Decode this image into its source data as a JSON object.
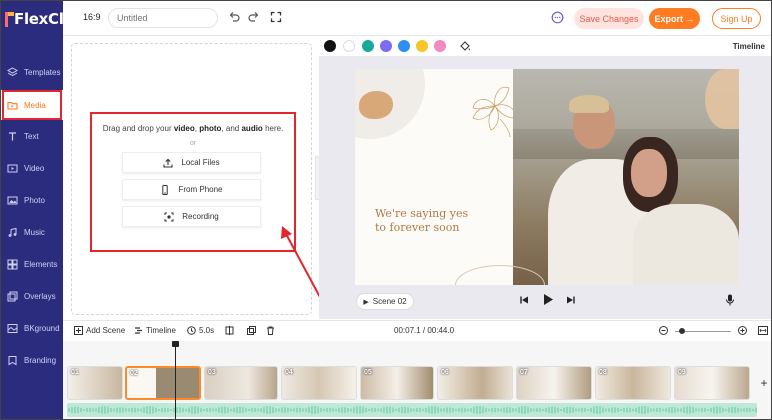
{
  "app": {
    "logo_text": "FlexClip"
  },
  "topbar": {
    "aspect_ratio": "16:9",
    "title_placeholder": "Untitled",
    "save_label": "Save Changes",
    "export_label": "Export →",
    "signup_label": "Sign Up"
  },
  "sidebar": {
    "items": [
      {
        "label": "Templates",
        "icon": "layers-icon"
      },
      {
        "label": "Media",
        "icon": "folder-icon",
        "active": true
      },
      {
        "label": "Text",
        "icon": "text-icon"
      },
      {
        "label": "Video",
        "icon": "video-icon"
      },
      {
        "label": "Photo",
        "icon": "photo-icon"
      },
      {
        "label": "Music",
        "icon": "music-icon"
      },
      {
        "label": "Elements",
        "icon": "elements-icon"
      },
      {
        "label": "Overlays",
        "icon": "overlays-icon"
      },
      {
        "label": "BKground",
        "icon": "background-icon"
      },
      {
        "label": "Branding",
        "icon": "branding-icon"
      }
    ]
  },
  "media": {
    "drag_prefix": "Drag and drop your",
    "drag_video": "video",
    "drag_comma": ",",
    "drag_photo": "photo",
    "drag_and": ", and",
    "drag_audio": "audio",
    "drag_suffix": "here.",
    "or_label": "or",
    "local_files": "Local Files",
    "from_phone": "From Phone",
    "recording": "Recording"
  },
  "canvas": {
    "colors": [
      "#111111",
      "#ffffff",
      "#1aa89a",
      "#7b6cf0",
      "#2f8ef0",
      "#f5c52a",
      "#f08ac0"
    ],
    "timeline_label": "Timeline",
    "slide_line1": "We're saying yes",
    "slide_line2": "to forever soon",
    "scene_label": "Scene 02"
  },
  "timeline": {
    "add_scene": "Add Scene",
    "timeline_label": "Timeline",
    "duration": "5.0s",
    "time_readout": "00:07.1 / 00:44.0",
    "clips": [
      "01",
      "02",
      "03",
      "04",
      "05",
      "06",
      "07",
      "08",
      "09"
    ]
  }
}
